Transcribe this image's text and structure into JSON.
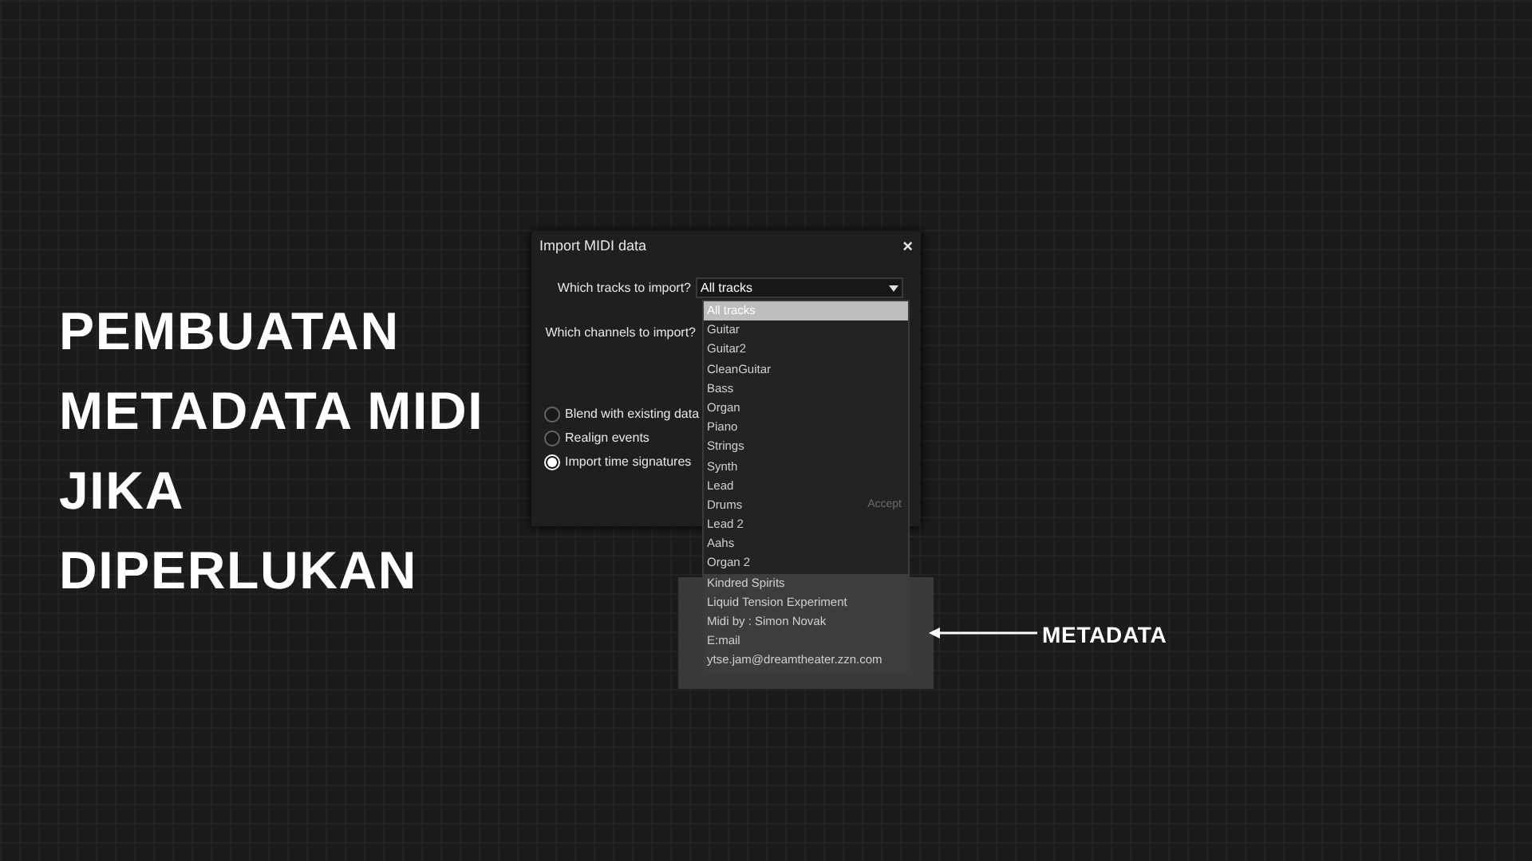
{
  "heading": [
    "PEMBUATAN",
    "METADATA MIDI",
    "JIKA",
    "DIPERLUKAN"
  ],
  "dialog": {
    "title": "Import MIDI data",
    "close": "×",
    "tracks_label": "Which tracks to import?",
    "tracks_value": "All tracks",
    "channels_label": "Which channels to import?",
    "options": [
      {
        "label": "Blend with existing data",
        "selected": false
      },
      {
        "label": "Realign events",
        "selected": false
      },
      {
        "label": "Import time signatures",
        "selected": true
      }
    ],
    "accept": "Accept",
    "track_list": [
      {
        "label": "All tracks",
        "selected": true,
        "highlighted": false
      },
      {
        "label": "Guitar",
        "selected": false,
        "highlighted": false
      },
      {
        "label": "Guitar2",
        "selected": false,
        "highlighted": false
      },
      {
        "label": "CleanGuitar",
        "selected": false,
        "highlighted": false
      },
      {
        "label": "Bass",
        "selected": false,
        "highlighted": false
      },
      {
        "label": "Organ",
        "selected": false,
        "highlighted": false
      },
      {
        "label": "Piano",
        "selected": false,
        "highlighted": false
      },
      {
        "label": "Strings",
        "selected": false,
        "highlighted": false
      },
      {
        "label": "Synth",
        "selected": false,
        "highlighted": false
      },
      {
        "label": "Lead",
        "selected": false,
        "highlighted": false
      },
      {
        "label": "Drums",
        "selected": false,
        "highlighted": false
      },
      {
        "label": "Lead 2",
        "selected": false,
        "highlighted": false
      },
      {
        "label": "Aahs",
        "selected": false,
        "highlighted": false
      },
      {
        "label": "Organ 2",
        "selected": false,
        "highlighted": false
      },
      {
        "label": "Kindred Spirits",
        "selected": false,
        "highlighted": true
      },
      {
        "label": "Liquid Tension Experiment",
        "selected": false,
        "highlighted": true
      },
      {
        "label": "Midi by : Simon Novak",
        "selected": false,
        "highlighted": true
      },
      {
        "label": "E:mail",
        "selected": false,
        "highlighted": true
      },
      {
        "label": "ytse.jam@dreamtheater.zzn.com",
        "selected": false,
        "highlighted": true
      }
    ]
  },
  "annotation": {
    "label": "METADATA"
  }
}
